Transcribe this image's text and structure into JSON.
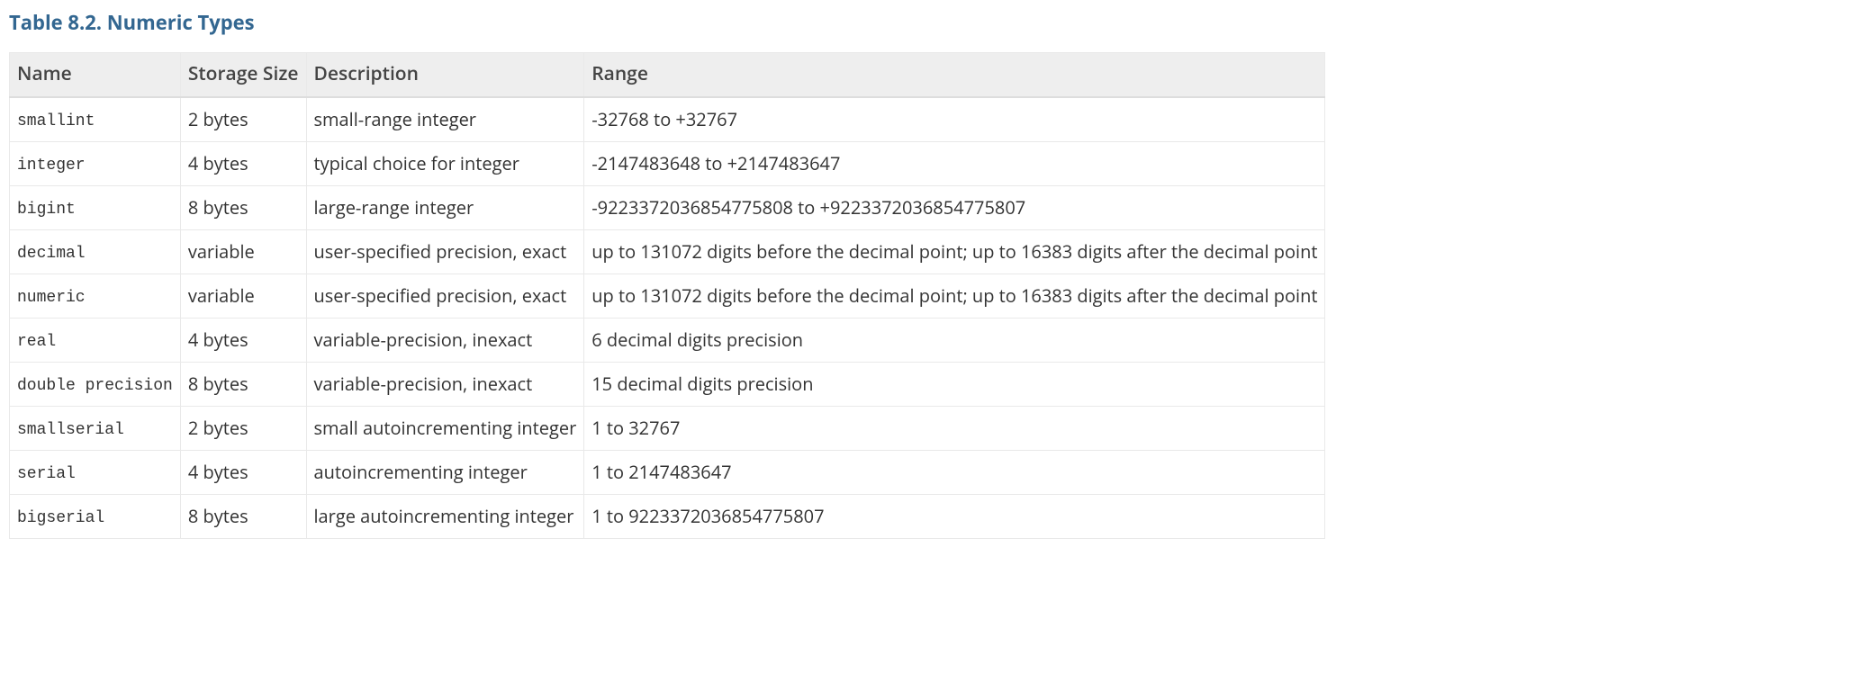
{
  "title": "Table 8.2. Numeric Types",
  "headers": {
    "name": "Name",
    "storage": "Storage Size",
    "description": "Description",
    "range": "Range"
  },
  "rows": [
    {
      "name": "smallint",
      "storage": "2 bytes",
      "description": "small-range integer",
      "range": "-32768 to +32767"
    },
    {
      "name": "integer",
      "storage": "4 bytes",
      "description": "typical choice for integer",
      "range": "-2147483648 to +2147483647"
    },
    {
      "name": "bigint",
      "storage": "8 bytes",
      "description": "large-range integer",
      "range": "-9223372036854775808 to +9223372036854775807"
    },
    {
      "name": "decimal",
      "storage": "variable",
      "description": "user-specified precision, exact",
      "range": "up to 131072 digits before the decimal point; up to 16383 digits after the decimal point"
    },
    {
      "name": "numeric",
      "storage": "variable",
      "description": "user-specified precision, exact",
      "range": "up to 131072 digits before the decimal point; up to 16383 digits after the decimal point"
    },
    {
      "name": "real",
      "storage": "4 bytes",
      "description": "variable-precision, inexact",
      "range": "6 decimal digits precision"
    },
    {
      "name": "double precision",
      "storage": "8 bytes",
      "description": "variable-precision, inexact",
      "range": "15 decimal digits precision"
    },
    {
      "name": "smallserial",
      "storage": "2 bytes",
      "description": "small autoincrementing integer",
      "range": "1 to 32767"
    },
    {
      "name": "serial",
      "storage": "4 bytes",
      "description": "autoincrementing integer",
      "range": "1 to 2147483647"
    },
    {
      "name": "bigserial",
      "storage": "8 bytes",
      "description": "large autoincrementing integer",
      "range": "1 to 9223372036854775807"
    }
  ]
}
